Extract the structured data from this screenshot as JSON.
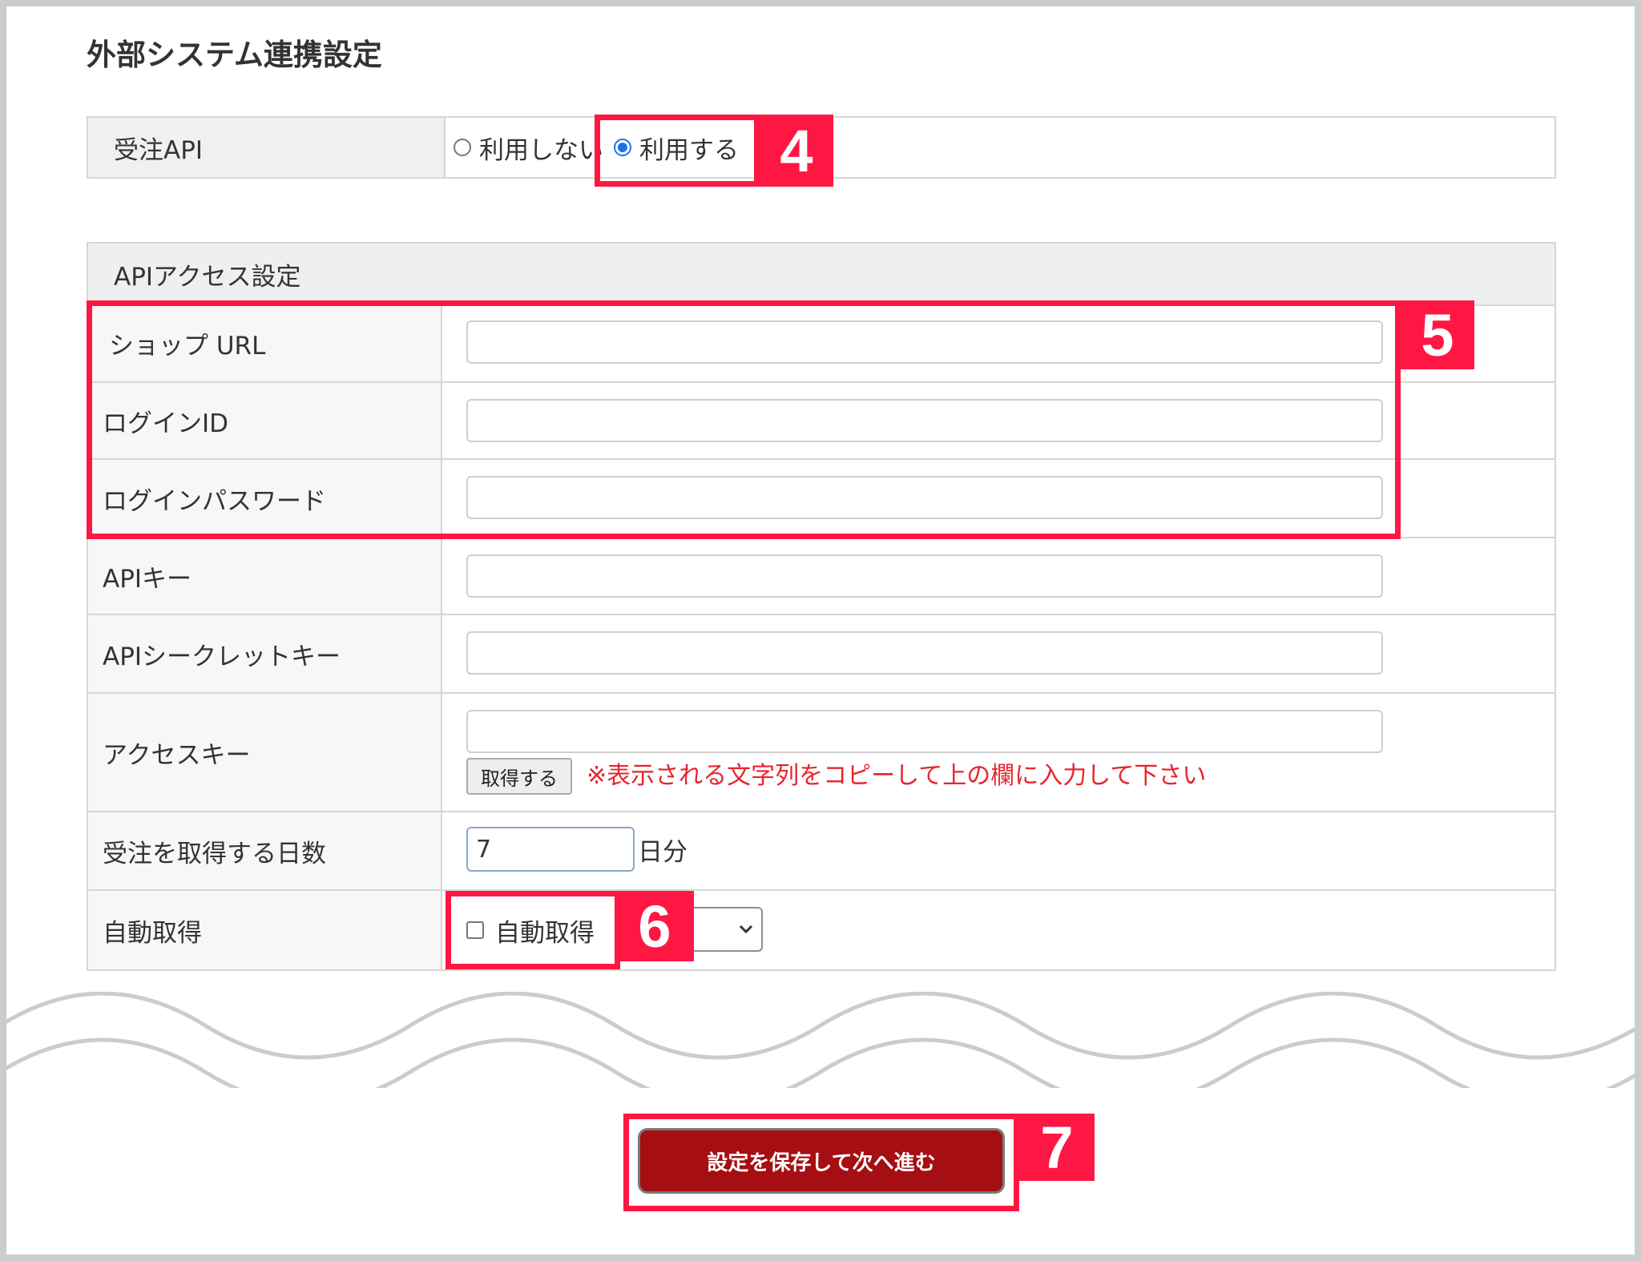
{
  "page": {
    "title": "外部システム連携設定"
  },
  "order_api": {
    "label": "受注API",
    "options": [
      {
        "label": "利用しない",
        "selected": false
      },
      {
        "label": "利用する",
        "selected": true
      }
    ]
  },
  "access_settings": {
    "heading": "APIアクセス設定",
    "rows": [
      {
        "label": "ショップ URL",
        "value": ""
      },
      {
        "label": "ログインID",
        "value": ""
      },
      {
        "label": "ログインパスワード",
        "value": ""
      },
      {
        "label": "APIキー",
        "value": ""
      },
      {
        "label": "APIシークレットキー",
        "value": ""
      }
    ],
    "access_key": {
      "label": "アクセスキー",
      "value": "",
      "button_label": "取得する",
      "note": "※表示される文字列をコピーして上の欄に入力して下さい"
    },
    "days": {
      "label": "受注を取得する日数",
      "value": "7",
      "unit": "日分"
    },
    "auto_fetch": {
      "label": "自動取得",
      "checkbox_label": "自動取得",
      "checked": false
    }
  },
  "save_button": {
    "label": "設定を保存して次へ進む"
  },
  "annotations": {
    "step4": "4",
    "step5": "5",
    "step6": "6",
    "step7": "7"
  },
  "colors": {
    "highlight": "#ff1744",
    "save_button": "#a50e12",
    "note_text": "#e8242b",
    "radio_selected": "#1a73e8"
  }
}
